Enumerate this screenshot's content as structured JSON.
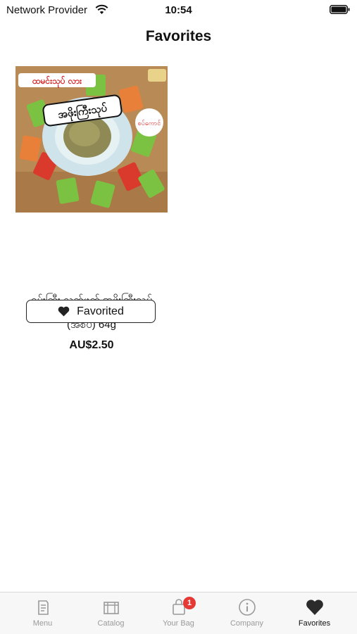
{
  "status_bar": {
    "carrier": "Network Provider",
    "time": "10:54"
  },
  "page": {
    "title": "Favorites"
  },
  "favorites": [
    {
      "name_line1": "ရှမ်းကြီး လက်ဖက် အဖိုးကြီးသုပ်",
      "name_line2": "(အစပ်) 64g",
      "price": "AU$2.50",
      "button_label": "Favorited",
      "image_text": {
        "top": "ထမင်းသုပ် လား",
        "center": "အဖိုးကြီးသုပ်",
        "tag": "စပ်ကောင်"
      }
    }
  ],
  "tab_bar": {
    "items": [
      {
        "label": "Menu",
        "icon": "menu-book-icon"
      },
      {
        "label": "Catalog",
        "icon": "catalog-icon"
      },
      {
        "label": "Your Bag",
        "icon": "bag-icon",
        "badge": "1"
      },
      {
        "label": "Company",
        "icon": "info-icon"
      },
      {
        "label": "Favorites",
        "icon": "heart-icon",
        "active": true
      }
    ]
  },
  "colors": {
    "badge": "#e53935",
    "tab_inactive": "#9a9a9a",
    "tab_active": "#111111"
  }
}
